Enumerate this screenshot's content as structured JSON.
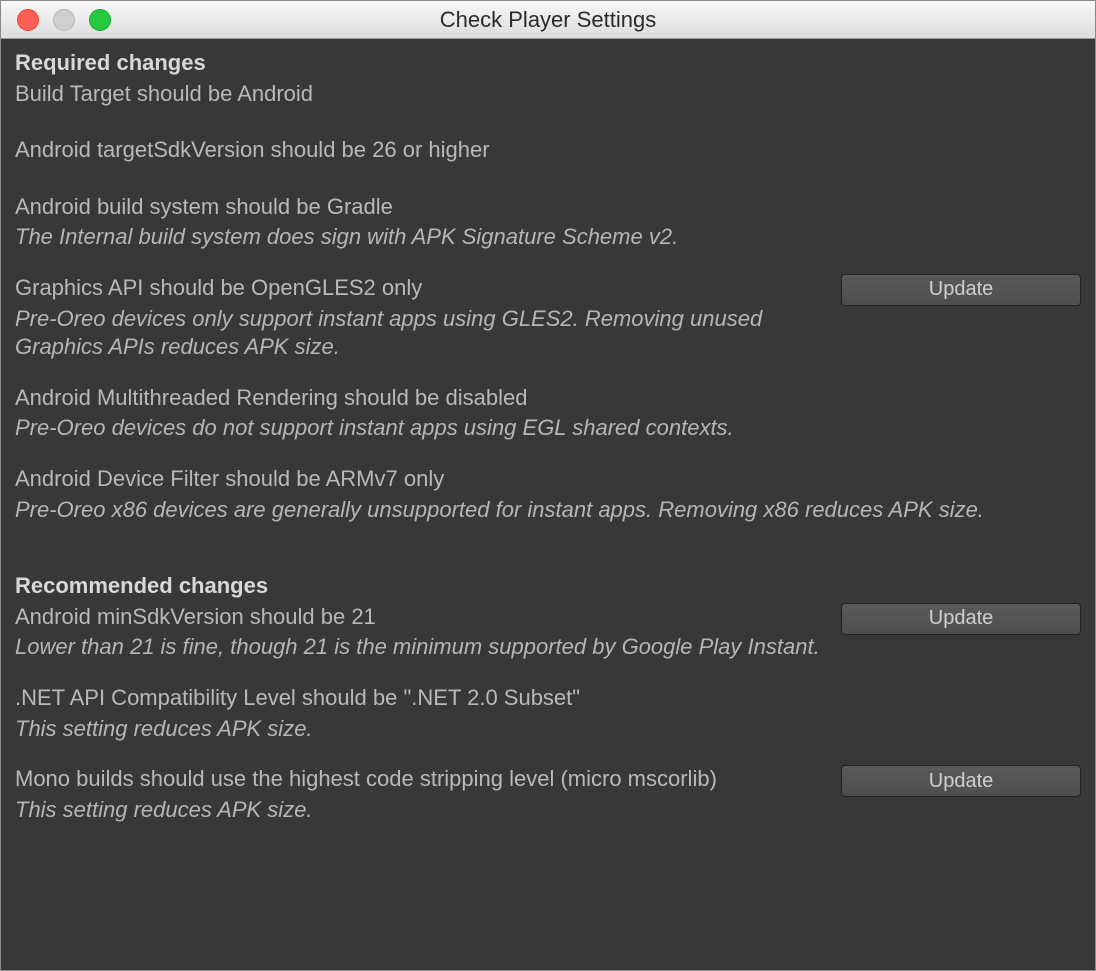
{
  "window": {
    "title": "Check Player Settings"
  },
  "buttons": {
    "update": "Update"
  },
  "sections": {
    "required": {
      "header": "Required changes",
      "items": [
        {
          "title": "Build Target should be Android",
          "desc": "",
          "hasButton": false
        },
        {
          "title": "Android targetSdkVersion should be 26 or higher",
          "desc": "",
          "hasButton": false
        },
        {
          "title": "Android build system should be Gradle",
          "desc": "The Internal build system does sign with APK Signature Scheme v2.",
          "hasButton": false
        },
        {
          "title": "Graphics API should be OpenGLES2 only",
          "desc": "Pre-Oreo devices only support instant apps using GLES2. Removing unused Graphics APIs reduces APK size.",
          "hasButton": true
        },
        {
          "title": "Android Multithreaded Rendering should be disabled",
          "desc": "Pre-Oreo devices do not support instant apps using EGL shared contexts.",
          "hasButton": false
        },
        {
          "title": "Android Device Filter should be ARMv7 only",
          "desc": "Pre-Oreo x86 devices are generally unsupported for instant apps. Removing x86 reduces APK size.",
          "hasButton": false
        }
      ]
    },
    "recommended": {
      "header": "Recommended changes",
      "items": [
        {
          "title": "Android minSdkVersion should be 21",
          "desc": "Lower than 21 is fine, though 21 is the minimum supported by Google Play Instant.",
          "hasButton": true
        },
        {
          "title": ".NET API Compatibility Level should be \".NET 2.0 Subset\"",
          "desc": "This setting reduces APK size.",
          "hasButton": false
        },
        {
          "title": "Mono builds should use the highest code stripping level (micro mscorlib)",
          "desc": "This setting reduces APK size.",
          "hasButton": true
        }
      ]
    }
  }
}
